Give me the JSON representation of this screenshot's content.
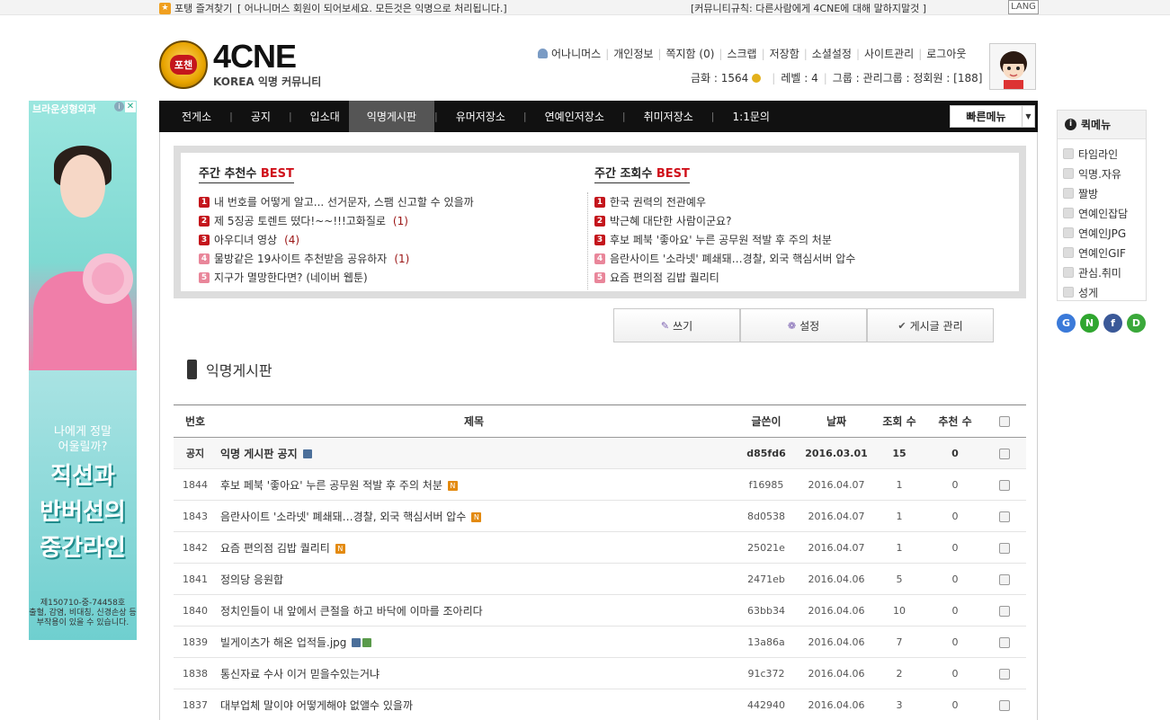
{
  "topbar": {
    "favorite": "포탱 즐겨찾기",
    "notice_left": "[ 어나니머스 회원이 되어보세요. 모든것은 익명으로 처리됩니다.]",
    "notice_right": "[커뮤니티규칙: 다른사람에게 4CNE에 대해 말하지말것 ]",
    "lang": "LANG"
  },
  "logo": {
    "badge": "포챈",
    "title": "4CNE",
    "subtitle": "KOREA 익명 커뮤니티"
  },
  "usermenu": {
    "items": [
      "어나니머스",
      "개인정보",
      "쪽지함 (0)",
      "스크랩",
      "저장함",
      "소셜설정",
      "사이트관리",
      "로그아웃"
    ]
  },
  "userinfo": {
    "gold": "금화 : 1564",
    "level": "레벨 : 4",
    "group": "그룹 : 관리그룹 : 정회원 : [188]"
  },
  "nav": {
    "items": [
      "전게소",
      "공지",
      "입소대",
      "익명게시판",
      "유머저장소",
      "연예인저장소",
      "취미저장소",
      "1:1문의"
    ],
    "quick": "빠른메뉴"
  },
  "best": {
    "recommend_title": "주간 추천수",
    "views_title": "주간 조회수",
    "best_word": "BEST",
    "recommend": [
      {
        "rank": "1",
        "title": "내 번호를 어떻게 알고... 선거문자, 스팸 신고할 수 있을까",
        "count": ""
      },
      {
        "rank": "2",
        "title": "제 5징공 토렌트 떴다!~~!!!고화질로",
        "count": "(1)"
      },
      {
        "rank": "3",
        "title": "아우디녀 영상",
        "count": "(4)"
      },
      {
        "rank": "4",
        "title": "물방같은 19사이트 추천받음 공유하자",
        "count": "(1)"
      },
      {
        "rank": "5",
        "title": "지구가 멸망한다면? (네이버 웹툰)",
        "count": ""
      }
    ],
    "views": [
      {
        "rank": "1",
        "title": "한국 권력의 전관예우"
      },
      {
        "rank": "2",
        "title": "박근혜 대단한 사람이군요?"
      },
      {
        "rank": "3",
        "title": "후보 페북 '좋아요' 누른 공무원 적발 후 주의 처분"
      },
      {
        "rank": "4",
        "title": "음란사이트 '소라넷' 폐쇄돼…경찰, 외국 핵심서버 압수"
      },
      {
        "rank": "5",
        "title": "요즘 편의점 김밥 퀄리티"
      }
    ]
  },
  "actions": {
    "write": "쓰기",
    "settings": "설정",
    "manage": "게시글 관리"
  },
  "board": {
    "title": "익명게시판",
    "headers": [
      "번호",
      "제목",
      "글쓴이",
      "날짜",
      "조회 수",
      "추천 수"
    ],
    "rows": [
      {
        "no": "공지",
        "title": "익명 게시판 공지",
        "author": "d85fd6",
        "date": "2016.03.01",
        "views": "15",
        "votes": "0",
        "notice": true,
        "new": false,
        "file": true,
        "img": false
      },
      {
        "no": "1844",
        "title": "후보 페북 '좋아요' 누른 공무원 적발 후 주의 처분",
        "author": "f16985",
        "date": "2016.04.07",
        "views": "1",
        "votes": "0",
        "notice": false,
        "new": true,
        "file": false,
        "img": false
      },
      {
        "no": "1843",
        "title": "음란사이트 '소라넷' 폐쇄돼…경찰, 외국 핵심서버 압수",
        "author": "8d0538",
        "date": "2016.04.07",
        "views": "1",
        "votes": "0",
        "notice": false,
        "new": true,
        "file": false,
        "img": false
      },
      {
        "no": "1842",
        "title": "요즘 편의점 김밥 퀄리티",
        "author": "25021e",
        "date": "2016.04.07",
        "views": "1",
        "votes": "0",
        "notice": false,
        "new": true,
        "file": false,
        "img": false
      },
      {
        "no": "1841",
        "title": "정의당 응원합",
        "author": "2471eb",
        "date": "2016.04.06",
        "views": "5",
        "votes": "0",
        "notice": false,
        "new": false,
        "file": false,
        "img": false
      },
      {
        "no": "1840",
        "title": "정치인들이 내 앞에서 큰절을 하고 바닥에 이마를 조아리다",
        "author": "63bb34",
        "date": "2016.04.06",
        "views": "10",
        "votes": "0",
        "notice": false,
        "new": false,
        "file": false,
        "img": false
      },
      {
        "no": "1839",
        "title": "빌게이츠가 해온 업적들.jpg",
        "author": "13a86a",
        "date": "2016.04.06",
        "views": "7",
        "votes": "0",
        "notice": false,
        "new": false,
        "file": true,
        "img": true
      },
      {
        "no": "1838",
        "title": "통신자료 수사 이거 믿을수있는거냐",
        "author": "91c372",
        "date": "2016.04.06",
        "views": "2",
        "votes": "0",
        "notice": false,
        "new": false,
        "file": false,
        "img": false
      },
      {
        "no": "1837",
        "title": "대부업체 말이야 어떻게해야 없앨수 있을까",
        "author": "442940",
        "date": "2016.04.06",
        "views": "3",
        "votes": "0",
        "notice": false,
        "new": false,
        "file": false,
        "img": false
      }
    ]
  },
  "ad": {
    "brand": "브라운성형외과",
    "question_line1": "나에게 정말",
    "question_line2": "어울릴까?",
    "big_line1": "직선과",
    "big_line2": "반버선의",
    "big_line3": "중간라인",
    "fine1": "제150710-중-74458호",
    "fine2": "출혈, 감염, 비대칭, 신경손상 등",
    "fine3": "부작용이 있을 수 있습니다."
  },
  "quickmenu": {
    "title": "퀵메뉴",
    "items": [
      "타임라인",
      "익명.자유",
      "짤방",
      "연예인잡담",
      "연예인JPG",
      "연예인GIF",
      "관심.취미",
      "성게"
    ]
  },
  "social": [
    "G",
    "N",
    "f",
    "D"
  ],
  "colors": {
    "nav_bg": "#111111",
    "nav_active": "#555555",
    "best_red": "#d0111b",
    "new_badge": "#e38a10"
  }
}
